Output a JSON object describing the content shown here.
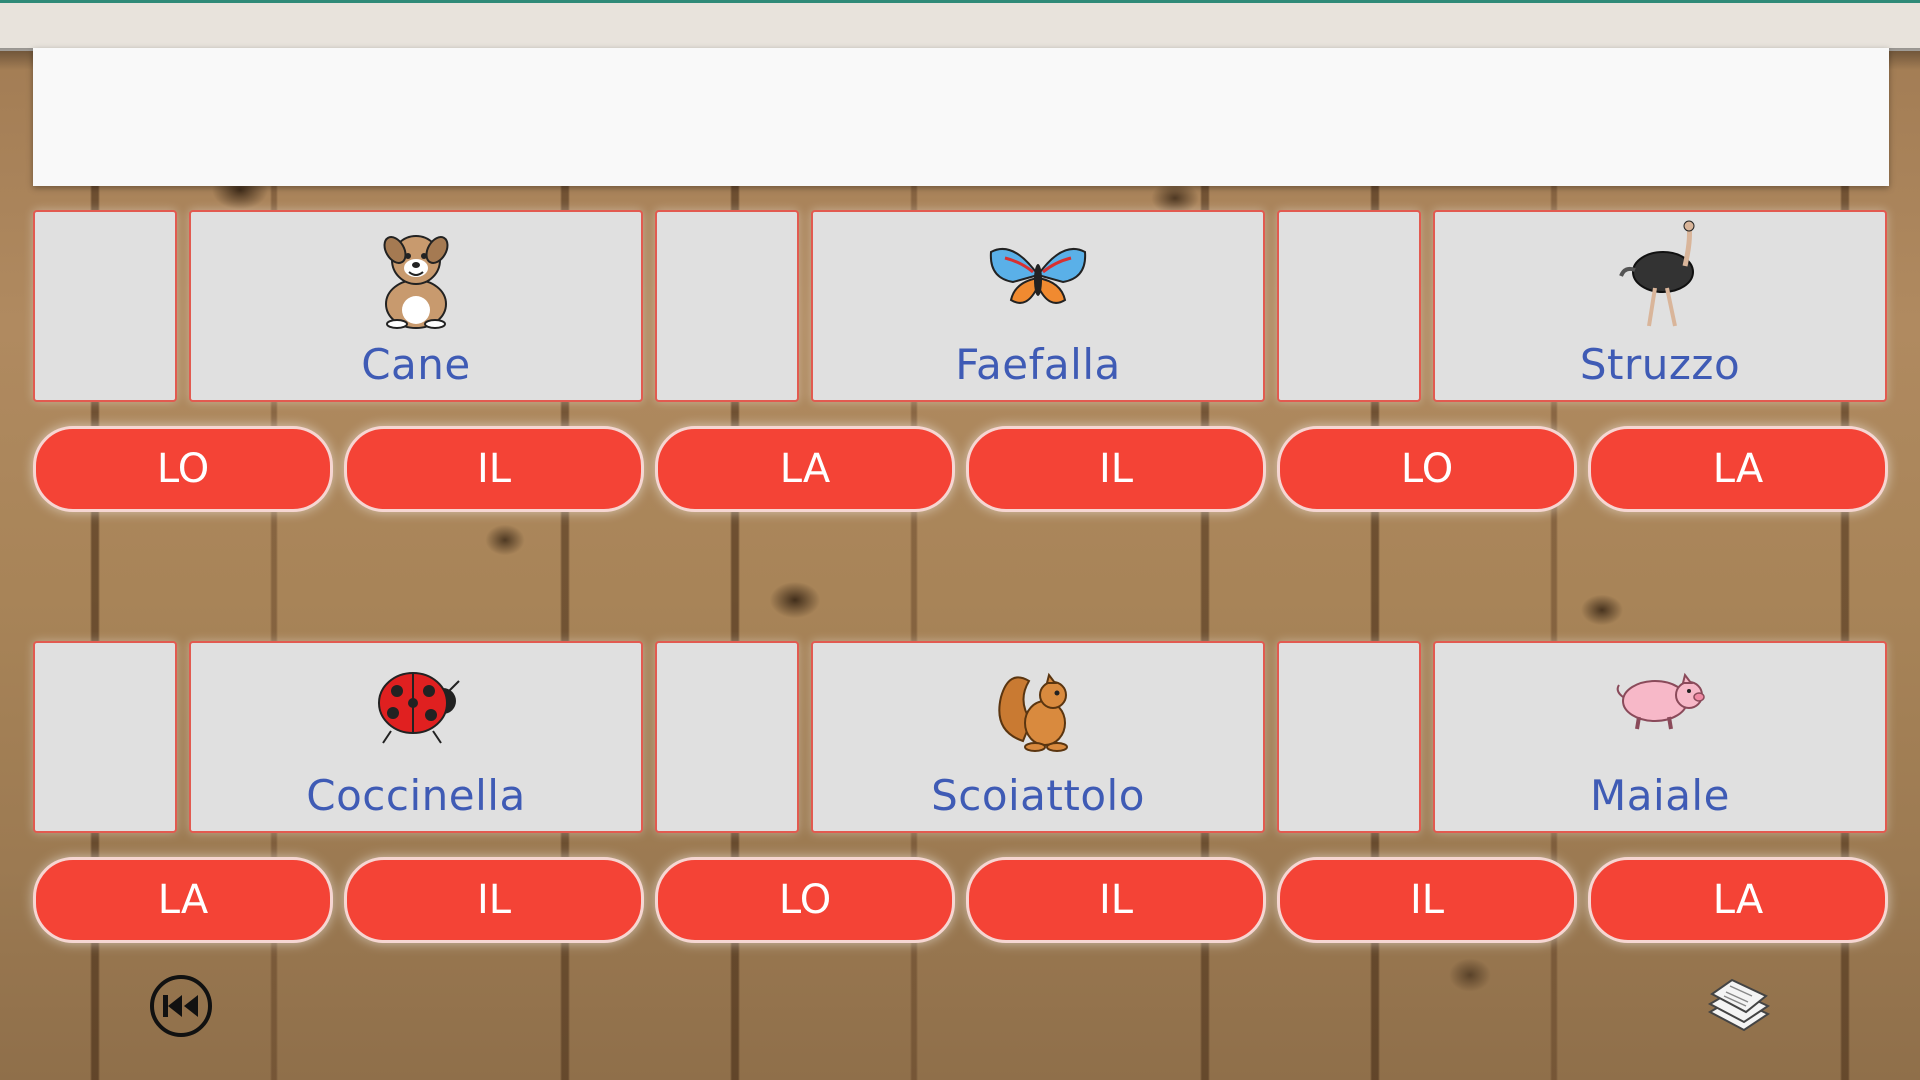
{
  "rows": [
    {
      "cards": [
        {
          "word": "Cane",
          "icon": "dog-icon"
        },
        {
          "word": "Faefalla",
          "icon": "butterfly-icon"
        },
        {
          "word": "Struzzo",
          "icon": "ostrich-icon"
        }
      ],
      "articles": [
        "LO",
        "IL",
        "LA",
        "IL",
        "LO",
        "LA"
      ]
    },
    {
      "cards": [
        {
          "word": "Coccinella",
          "icon": "ladybug-icon"
        },
        {
          "word": "Scoiattolo",
          "icon": "squirrel-icon"
        },
        {
          "word": "Maiale",
          "icon": "pig-icon"
        }
      ],
      "articles": [
        "LA",
        "IL",
        "LO",
        "IL",
        "IL",
        "LA"
      ]
    }
  ],
  "controls": {
    "back_icon": "rewind-icon",
    "mode_icon": "stack-of-papers-icon"
  },
  "colors": {
    "article_button": "#f44336",
    "word_text": "#3f5bb5",
    "card_border": "#e25a50",
    "top_accent": "#2f8a78"
  }
}
